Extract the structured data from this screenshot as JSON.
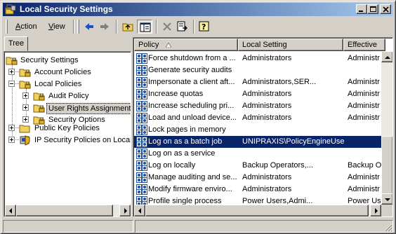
{
  "window": {
    "title": "Local Security Settings"
  },
  "menu": {
    "action_pre": "",
    "action_key": "A",
    "action_post": "ction",
    "view_pre": "",
    "view_key": "V",
    "view_post": "iew"
  },
  "tabs": {
    "tree": "Tree"
  },
  "tree": {
    "root": "Security Settings",
    "account_policies": "Account Policies",
    "local_policies": "Local Policies",
    "audit_policy": "Audit Policy",
    "user_rights": "User Rights Assignment",
    "security_options": "Security Options",
    "public_key": "Public Key Policies",
    "ip_security": "IP Security Policies on Local I"
  },
  "list": {
    "headers": {
      "policy": "Policy",
      "local": "Local Setting",
      "effective": "Effective"
    },
    "rows": [
      {
        "policy": "Force shutdown from a ...",
        "local": "Administrators",
        "effective": "Administr"
      },
      {
        "policy": "Generate security audits",
        "local": "",
        "effective": ""
      },
      {
        "policy": "Impersonate a client aft...",
        "local": "Administrators,SER...",
        "effective": "Administr"
      },
      {
        "policy": "Increase quotas",
        "local": "Administrators",
        "effective": "Administr"
      },
      {
        "policy": "Increase scheduling pri...",
        "local": "Administrators",
        "effective": "Administr"
      },
      {
        "policy": "Load and unload device...",
        "local": "Administrators",
        "effective": "Administr"
      },
      {
        "policy": "Lock pages in memory",
        "local": "",
        "effective": ""
      },
      {
        "policy": "Log on as a batch job",
        "local": "UNIPRAXIS\\PolicyEngineUser",
        "effective": ""
      },
      {
        "policy": "Log on as a service",
        "local": "",
        "effective": ""
      },
      {
        "policy": "Log on locally",
        "local": "Backup Operators,...",
        "effective": "Backup O"
      },
      {
        "policy": "Manage auditing and se...",
        "local": "Administrators",
        "effective": "Administr"
      },
      {
        "policy": "Modify firmware enviro...",
        "local": "Administrators",
        "effective": "Administr"
      },
      {
        "policy": "Profile single process",
        "local": "Power Users,Admi...",
        "effective": "Power Us"
      }
    ]
  },
  "colors": {
    "title_start": "#0a246a",
    "title_end": "#a6caf0",
    "selection": "#0a246a",
    "chrome": "#d4d0c8"
  },
  "icons": [
    "app-security-icon",
    "minimize-icon",
    "maximize-icon",
    "close-icon",
    "back-arrow-icon",
    "forward-arrow-icon",
    "up-folder-icon",
    "show-hide-tree-icon",
    "delete-icon",
    "export-list-icon",
    "help-icon",
    "policy-icon",
    "folder-icon",
    "lock-folder-icon",
    "network-shield-icon"
  ]
}
